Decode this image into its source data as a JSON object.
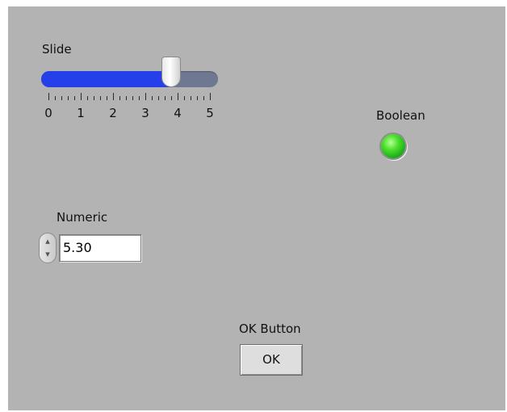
{
  "slide": {
    "label": "Slide",
    "value": 3.8,
    "min": 0,
    "max": 5,
    "scale_labels": [
      "0",
      "1",
      "2",
      "3",
      "4",
      "5"
    ],
    "fill_color": "#2540e8",
    "track_color": "#6f7891"
  },
  "boolean": {
    "label": "Boolean",
    "state": true,
    "led_color": "#44dd22"
  },
  "numeric": {
    "label": "Numeric",
    "value": "5.30"
  },
  "ok_button": {
    "label": "OK Button",
    "text": "OK"
  },
  "colors": {
    "panel_background": "#b3b3b3"
  }
}
